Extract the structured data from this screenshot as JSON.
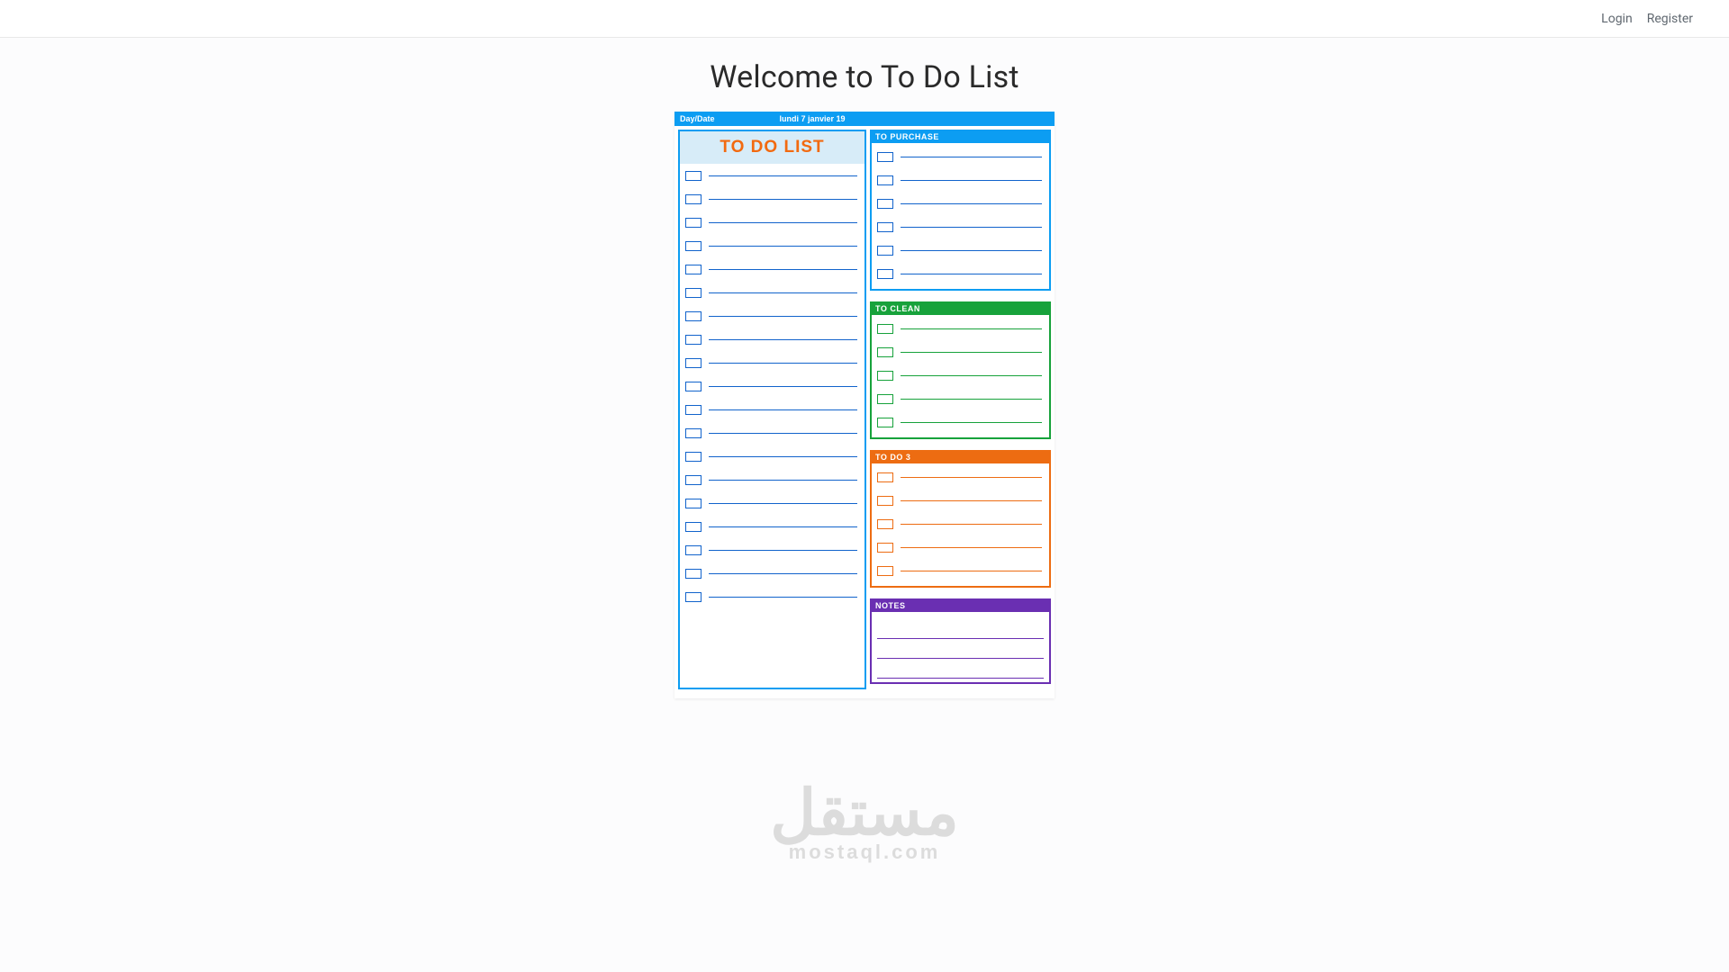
{
  "header": {
    "login": "Login",
    "register": "Register"
  },
  "page_title": "Welcome to To Do List",
  "sheet": {
    "date_label": "Day/Date",
    "date_value": "lundi 7 janvier 19",
    "main_title": "TO DO LIST",
    "main_rows": 19,
    "sections": {
      "purchase": {
        "title": "TO PURCHASE",
        "rows": 6,
        "color": "#0c9df2"
      },
      "clean": {
        "title": "TO CLEAN",
        "rows": 5,
        "color": "#17a23b"
      },
      "todo3": {
        "title": "TO DO 3",
        "rows": 5,
        "color": "#ed6c12"
      },
      "notes": {
        "title": "NOTES",
        "rows": 3,
        "color": "#6a2fb2"
      }
    }
  },
  "watermark": {
    "arabic": "مستقل",
    "latin": "mostaql.com"
  }
}
